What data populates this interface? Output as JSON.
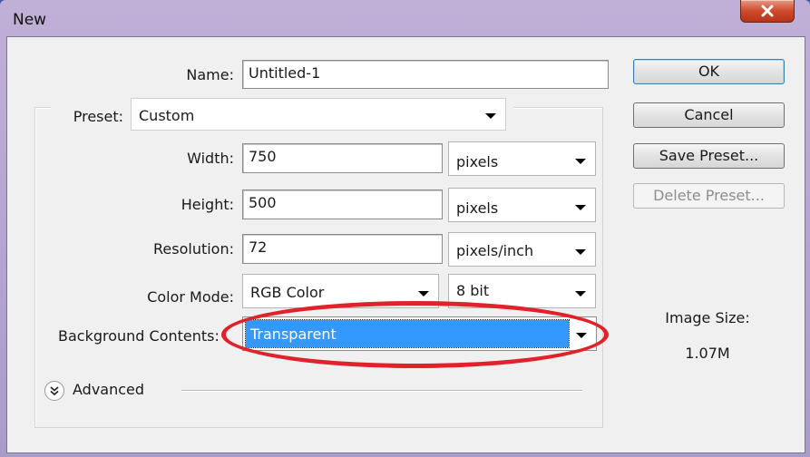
{
  "window": {
    "title": "New"
  },
  "form": {
    "name_label": "Name:",
    "name_value": "Untitled-1",
    "preset_label": "Preset:",
    "preset_value": "Custom",
    "width_label": "Width:",
    "width_value": "750",
    "width_unit": "pixels",
    "height_label": "Height:",
    "height_value": "500",
    "height_unit": "pixels",
    "resolution_label": "Resolution:",
    "resolution_value": "72",
    "resolution_unit": "pixels/inch",
    "color_mode_label": "Color Mode:",
    "color_mode_value": "RGB Color",
    "bit_depth_value": "8 bit",
    "background_label": "Background Contents:",
    "background_value": "Transparent",
    "advanced_label": "Advanced"
  },
  "buttons": {
    "ok": "OK",
    "cancel": "Cancel",
    "save_preset": "Save Preset...",
    "delete_preset": "Delete Preset..."
  },
  "image_size": {
    "label": "Image Size:",
    "value": "1.07M"
  },
  "colors": {
    "selection": "#3399ff",
    "annotation": "#e0222a",
    "window_frame": "#a99cc9",
    "close_button": "#cf4a2b"
  },
  "icons": {
    "close": "close-icon",
    "advanced_toggle": "double-chevron-down-icon",
    "dropdown": "chevron-down-icon"
  }
}
